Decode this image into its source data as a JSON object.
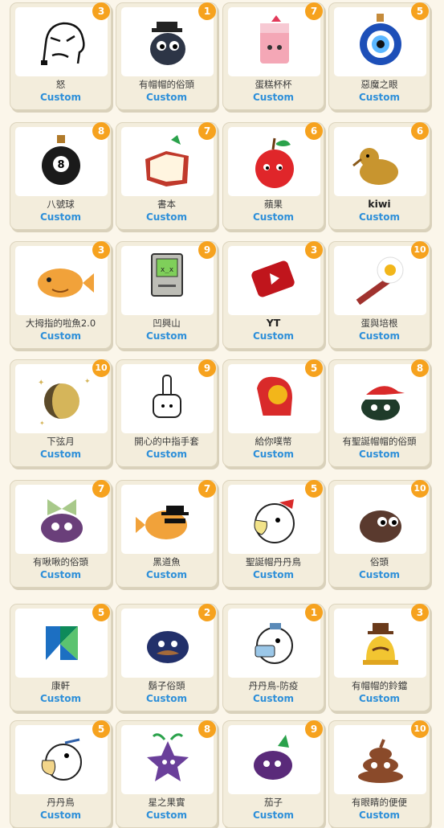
{
  "custom_label": "Custom",
  "accent_color": "#2d8fd9",
  "badge_color": "#f6a21e",
  "items": [
    {
      "name": "怒",
      "count": "3",
      "icon": "angry-face-icon"
    },
    {
      "name": "有帽帽的俗頭",
      "count": "1",
      "icon": "hat-blob-icon"
    },
    {
      "name": "蛋糕杯杯",
      "count": "7",
      "icon": "cake-cup-icon"
    },
    {
      "name": "惡魔之眼",
      "count": "5",
      "icon": "evil-eye-icon"
    },
    {
      "name": "八號球",
      "count": "8",
      "icon": "eight-ball-icon"
    },
    {
      "name": "書本",
      "count": "7",
      "icon": "book-icon"
    },
    {
      "name": "蘋果",
      "count": "6",
      "icon": "apple-icon"
    },
    {
      "name": "kiwi",
      "count": "6",
      "icon": "kiwi-bird-icon"
    },
    {
      "name": "大拇指的啦魚2.0",
      "count": "3",
      "icon": "taiyaki-icon"
    },
    {
      "name": "凹興山",
      "count": "9",
      "icon": "retro-computer-icon"
    },
    {
      "name": "YT",
      "count": "3",
      "icon": "youtube-icon"
    },
    {
      "name": "蛋與培根",
      "count": "10",
      "icon": "egg-bacon-icon"
    },
    {
      "name": "下弦月",
      "count": "10",
      "icon": "moon-icon"
    },
    {
      "name": "開心的中指手套",
      "count": "9",
      "icon": "middle-finger-glove-icon"
    },
    {
      "name": "給你噗幣",
      "count": "5",
      "icon": "mitten-coin-icon"
    },
    {
      "name": "有聖誕帽帽的俗頭",
      "count": "8",
      "icon": "santa-blob-icon"
    },
    {
      "name": "有啾啾的俗頭",
      "count": "7",
      "icon": "bow-blob-icon"
    },
    {
      "name": "黑道魚",
      "count": "7",
      "icon": "gangster-fish-icon"
    },
    {
      "name": "聖誕帽丹丹鳥",
      "count": "5",
      "icon": "santa-bird-icon"
    },
    {
      "name": "俗頭",
      "count": "10",
      "icon": "brown-blob-icon"
    },
    {
      "name": "康軒",
      "count": "5",
      "icon": "kangxuan-logo-icon"
    },
    {
      "name": "鬍子俗頭",
      "count": "2",
      "icon": "mustache-blob-icon"
    },
    {
      "name": "丹丹鳥-防疫",
      "count": "1",
      "icon": "mask-bird-icon"
    },
    {
      "name": "有帽帽的鈴鐺",
      "count": "3",
      "icon": "bell-icon"
    },
    {
      "name": "丹丹鳥",
      "count": "5",
      "icon": "bird-icon"
    },
    {
      "name": "星之果實",
      "count": "8",
      "icon": "star-fruit-icon"
    },
    {
      "name": "茄子",
      "count": "9",
      "icon": "eggplant-icon"
    },
    {
      "name": "有眼睛的便便",
      "count": "10",
      "icon": "poop-icon"
    }
  ]
}
